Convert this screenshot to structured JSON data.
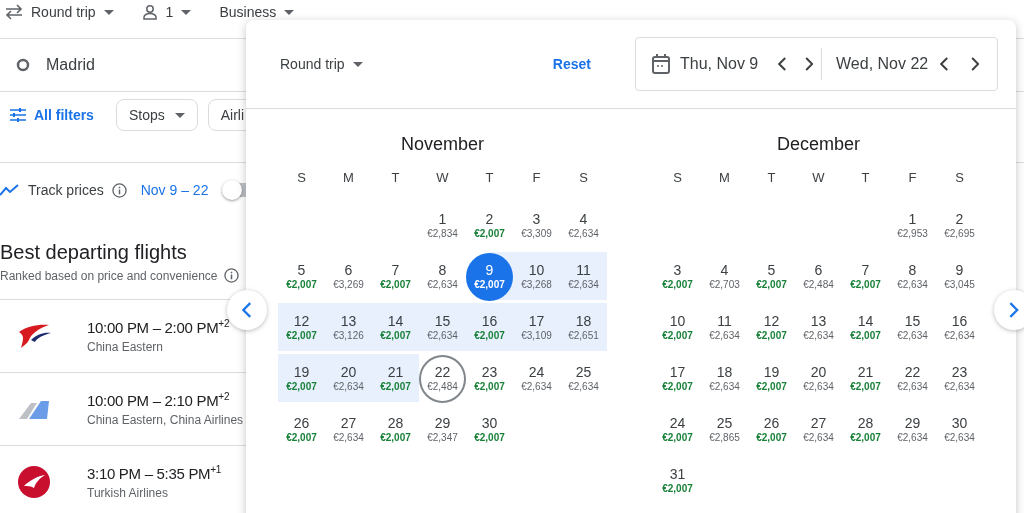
{
  "top_bar": {
    "trip_type": "Round trip",
    "passengers": "1",
    "cabin": "Business"
  },
  "origin": "Madrid",
  "filters": {
    "all_filters": "All filters",
    "chips": [
      "Stops",
      "Airli"
    ]
  },
  "track": {
    "label": "Track prices",
    "dates": "Nov 9 – 22",
    "on": false
  },
  "section": {
    "title": "Best departing flights",
    "subtitle": "Ranked based on price and convenience"
  },
  "flights": [
    {
      "kind": "swoosh",
      "times": "10:00 PM – 2:00 PM$^{+2}$",
      "airline": "China Eastern"
    },
    {
      "kind": "fin",
      "times": "10:00 PM – 2:10 PM$^{+2}$",
      "airline": "China Eastern, China Airlines"
    },
    {
      "kind": "roundel",
      "times": "3:10 PM – 5:35 PM$^{+1}$",
      "airline": "Turkish Airlines"
    }
  ],
  "date_picker": {
    "trip_type": "Round trip",
    "reset": "Reset",
    "departure": "Thu, Nov 9",
    "return": "Wed, Nov 22",
    "months": [
      {
        "name": "November",
        "weekdays": [
          "S",
          "M",
          "T",
          "W",
          "T",
          "F",
          "S"
        ],
        "days": [
          {
            "kind": "blank"
          },
          {
            "kind": "blank"
          },
          {
            "kind": "blank"
          },
          {
            "kind": "day",
            "day": "1",
            "price": "€2,834",
            "cheap": false,
            "selected": false,
            "in_range": false
          },
          {
            "kind": "day",
            "day": "2",
            "price": "€2,007",
            "cheap": true,
            "selected": false,
            "in_range": false
          },
          {
            "kind": "day",
            "day": "3",
            "price": "€3,309",
            "cheap": false,
            "selected": false,
            "in_range": false
          },
          {
            "kind": "day",
            "day": "4",
            "price": "€2,634",
            "cheap": false,
            "selected": false,
            "in_range": false
          },
          {
            "kind": "day",
            "day": "5",
            "price": "€2,007",
            "cheap": true,
            "selected": false,
            "in_range": false
          },
          {
            "kind": "day",
            "day": "6",
            "price": "€3,269",
            "cheap": false,
            "selected": false,
            "in_range": false
          },
          {
            "kind": "day",
            "day": "7",
            "price": "€2,007",
            "cheap": true,
            "selected": false,
            "in_range": false
          },
          {
            "kind": "day",
            "day": "8",
            "price": "€2,634",
            "cheap": false,
            "selected": false,
            "in_range": false
          },
          {
            "kind": "day",
            "day": "9",
            "price": "€2,007",
            "cheap": true,
            "selected": true,
            "in_range": true
          },
          {
            "kind": "day",
            "day": "10",
            "price": "€3,268",
            "cheap": false,
            "selected": false,
            "in_range": true
          },
          {
            "kind": "day",
            "day": "11",
            "price": "€2,634",
            "cheap": false,
            "selected": false,
            "in_range": true
          },
          {
            "kind": "day",
            "day": "12",
            "price": "€2,007",
            "cheap": true,
            "selected": false,
            "in_range": true
          },
          {
            "kind": "day",
            "day": "13",
            "price": "€3,126",
            "cheap": false,
            "selected": false,
            "in_range": true
          },
          {
            "kind": "day",
            "day": "14",
            "price": "€2,007",
            "cheap": true,
            "selected": false,
            "in_range": true
          },
          {
            "kind": "day",
            "day": "15",
            "price": "€2,634",
            "cheap": false,
            "selected": false,
            "in_range": true
          },
          {
            "kind": "day",
            "day": "16",
            "price": "€2,007",
            "cheap": true,
            "selected": false,
            "in_range": true
          },
          {
            "kind": "day",
            "day": "17",
            "price": "€3,109",
            "cheap": false,
            "selected": false,
            "in_range": true
          },
          {
            "kind": "day",
            "day": "18",
            "price": "€2,651",
            "cheap": false,
            "selected": false,
            "in_range": true
          },
          {
            "kind": "day",
            "day": "19",
            "price": "€2,007",
            "cheap": true,
            "selected": false,
            "in_range": true
          },
          {
            "kind": "day",
            "day": "20",
            "price": "€2,634",
            "cheap": false,
            "selected": false,
            "in_range": true
          },
          {
            "kind": "day",
            "day": "21",
            "price": "€2,007",
            "cheap": true,
            "selected": false,
            "in_range": true
          },
          {
            "kind": "day",
            "day": "22",
            "price": "€2,484",
            "cheap": false,
            "selected": true,
            "in_range": false
          },
          {
            "kind": "day",
            "day": "23",
            "price": "€2,007",
            "cheap": true,
            "selected": false,
            "in_range": false
          },
          {
            "kind": "day",
            "day": "24",
            "price": "€2,634",
            "cheap": false,
            "selected": false,
            "in_range": false
          },
          {
            "kind": "day",
            "day": "25",
            "price": "€2,634",
            "cheap": false,
            "selected": false,
            "in_range": false
          },
          {
            "kind": "day",
            "day": "26",
            "price": "€2,007",
            "cheap": true,
            "selected": false,
            "in_range": false
          },
          {
            "kind": "day",
            "day": "27",
            "price": "€2,634",
            "cheap": false,
            "selected": false,
            "in_range": false
          },
          {
            "kind": "day",
            "day": "28",
            "price": "€2,007",
            "cheap": true,
            "selected": false,
            "in_range": false
          },
          {
            "kind": "day",
            "day": "29",
            "price": "€2,347",
            "cheap": false,
            "selected": false,
            "in_range": false
          },
          {
            "kind": "day",
            "day": "30",
            "price": "€2,007",
            "cheap": true,
            "selected": false,
            "in_range": false
          }
        ]
      },
      {
        "name": "December",
        "weekdays": [
          "S",
          "M",
          "T",
          "W",
          "T",
          "F",
          "S"
        ],
        "days": [
          {
            "kind": "blank"
          },
          {
            "kind": "blank"
          },
          {
            "kind": "blank"
          },
          {
            "kind": "blank"
          },
          {
            "kind": "blank"
          },
          {
            "kind": "day",
            "day": "1",
            "price": "€2,953",
            "cheap": false,
            "selected": false,
            "in_range": false
          },
          {
            "kind": "day",
            "day": "2",
            "price": "€2,695",
            "cheap": false,
            "selected": false,
            "in_range": false
          },
          {
            "kind": "day",
            "day": "3",
            "price": "€2,007",
            "cheap": true,
            "selected": false,
            "in_range": false
          },
          {
            "kind": "day",
            "day": "4",
            "price": "€2,703",
            "cheap": false,
            "selected": false,
            "in_range": false
          },
          {
            "kind": "day",
            "day": "5",
            "price": "€2,007",
            "cheap": true,
            "selected": false,
            "in_range": false
          },
          {
            "kind": "day",
            "day": "6",
            "price": "€2,484",
            "cheap": false,
            "selected": false,
            "in_range": false
          },
          {
            "kind": "day",
            "day": "7",
            "price": "€2,007",
            "cheap": true,
            "selected": false,
            "in_range": false
          },
          {
            "kind": "day",
            "day": "8",
            "price": "€2,634",
            "cheap": false,
            "selected": false,
            "in_range": false
          },
          {
            "kind": "day",
            "day": "9",
            "price": "€3,045",
            "cheap": false,
            "selected": false,
            "in_range": false
          },
          {
            "kind": "day",
            "day": "10",
            "price": "€2,007",
            "cheap": true,
            "selected": false,
            "in_range": false
          },
          {
            "kind": "day",
            "day": "11",
            "price": "€2,634",
            "cheap": false,
            "selected": false,
            "in_range": false
          },
          {
            "kind": "day",
            "day": "12",
            "price": "€2,007",
            "cheap": true,
            "selected": false,
            "in_range": false
          },
          {
            "kind": "day",
            "day": "13",
            "price": "€2,634",
            "cheap": false,
            "selected": false,
            "in_range": false
          },
          {
            "kind": "day",
            "day": "14",
            "price": "€2,007",
            "cheap": true,
            "selected": false,
            "in_range": false
          },
          {
            "kind": "day",
            "day": "15",
            "price": "€2,634",
            "cheap": false,
            "selected": false,
            "in_range": false
          },
          {
            "kind": "day",
            "day": "16",
            "price": "€2,634",
            "cheap": false,
            "selected": false,
            "in_range": false
          },
          {
            "kind": "day",
            "day": "17",
            "price": "€2,007",
            "cheap": true,
            "selected": false,
            "in_range": false
          },
          {
            "kind": "day",
            "day": "18",
            "price": "€2,634",
            "cheap": false,
            "selected": false,
            "in_range": false
          },
          {
            "kind": "day",
            "day": "19",
            "price": "€2,007",
            "cheap": true,
            "selected": false,
            "in_range": false
          },
          {
            "kind": "day",
            "day": "20",
            "price": "€2,634",
            "cheap": false,
            "selected": false,
            "in_range": false
          },
          {
            "kind": "day",
            "day": "21",
            "price": "€2,007",
            "cheap": true,
            "selected": false,
            "in_range": false
          },
          {
            "kind": "day",
            "day": "22",
            "price": "€2,634",
            "cheap": false,
            "selected": false,
            "in_range": false
          },
          {
            "kind": "day",
            "day": "23",
            "price": "€2,634",
            "cheap": false,
            "selected": false,
            "in_range": false
          },
          {
            "kind": "day",
            "day": "24",
            "price": "€2,007",
            "cheap": true,
            "selected": false,
            "in_range": false
          },
          {
            "kind": "day",
            "day": "25",
            "price": "€2,865",
            "cheap": false,
            "selected": false,
            "in_range": false
          },
          {
            "kind": "day",
            "day": "26",
            "price": "€2,007",
            "cheap": true,
            "selected": false,
            "in_range": false
          },
          {
            "kind": "day",
            "day": "27",
            "price": "€2,634",
            "cheap": false,
            "selected": false,
            "in_range": false
          },
          {
            "kind": "day",
            "day": "28",
            "price": "€2,007",
            "cheap": true,
            "selected": false,
            "in_range": false
          },
          {
            "kind": "day",
            "day": "29",
            "price": "€2,634",
            "cheap": false,
            "selected": false,
            "in_range": false
          },
          {
            "kind": "day",
            "day": "30",
            "price": "€2,634",
            "cheap": false,
            "selected": false,
            "in_range": false
          },
          {
            "kind": "day",
            "day": "31",
            "price": "€2,007",
            "cheap": true,
            "selected": false,
            "in_range": false
          }
        ]
      }
    ]
  }
}
